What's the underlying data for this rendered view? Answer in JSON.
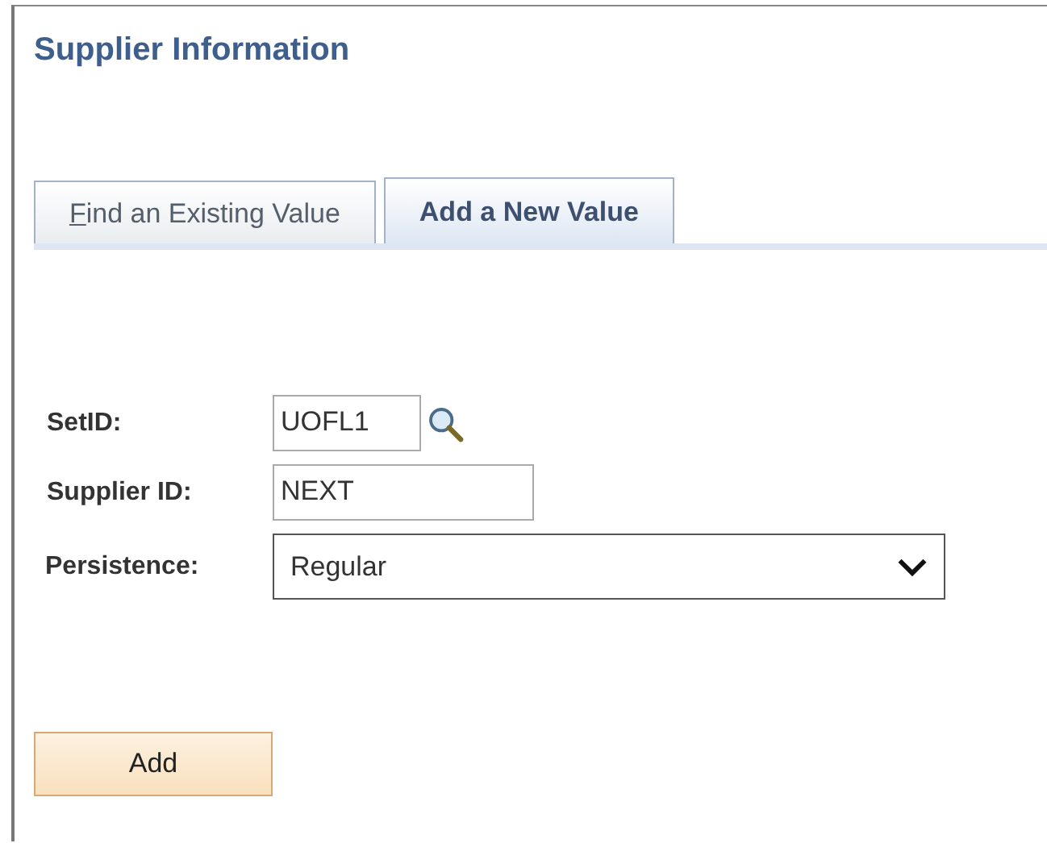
{
  "page": {
    "title": "Supplier Information"
  },
  "tabs": [
    {
      "label": "Find an Existing Value",
      "selected": false,
      "accesskey_underlined": true
    },
    {
      "label": "Add a New Value",
      "selected": true,
      "accesskey_underlined": false
    }
  ],
  "fields": [
    {
      "kind": "lookup",
      "label": "SetID:",
      "value": "UOFL1"
    },
    {
      "kind": "text",
      "label": "Supplier ID:",
      "value": "NEXT"
    },
    {
      "kind": "select",
      "label": "Persistence:",
      "value": "Regular"
    }
  ],
  "buttons": [
    {
      "label": "Add"
    }
  ]
}
